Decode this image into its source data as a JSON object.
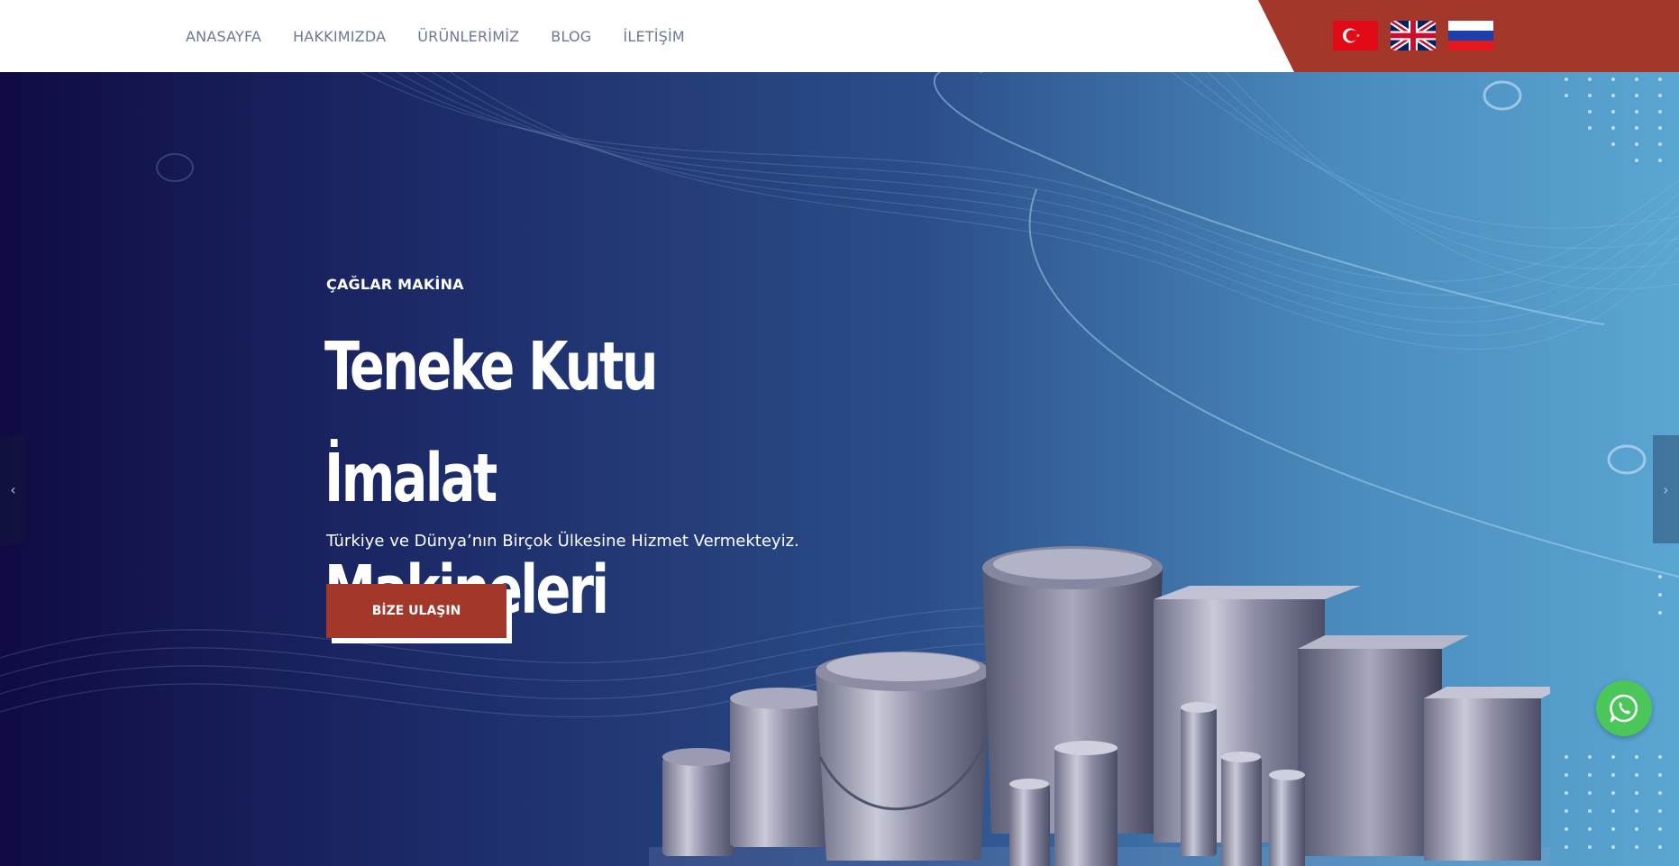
{
  "nav": {
    "items": [
      {
        "label": "ANASAYFA"
      },
      {
        "label": "HAKKIMIZDA"
      },
      {
        "label": "ÜRÜNLERİMİZ"
      },
      {
        "label": "BLOG"
      },
      {
        "label": "İLETİŞİM"
      }
    ]
  },
  "languages": {
    "flags": [
      "turkey-flag-icon",
      "uk-flag-icon",
      "russia-flag-icon"
    ]
  },
  "hero": {
    "eyebrow": "ÇAĞLAR MAKİNA",
    "title": "Teneke Kutu İmalat Makineleri",
    "subtitle": "Türkiye ve Dünya’nın Birçok Ülkesine Hizmet Vermekteyiz.",
    "cta_label": "BİZE ULAŞIN"
  },
  "slider": {
    "prev_icon": "‹",
    "next_icon": "›"
  },
  "colors": {
    "accent": "#a3382a",
    "header_bg": "#ffffff",
    "nav_text": "#6c7896",
    "whatsapp": "#4bc75a"
  }
}
